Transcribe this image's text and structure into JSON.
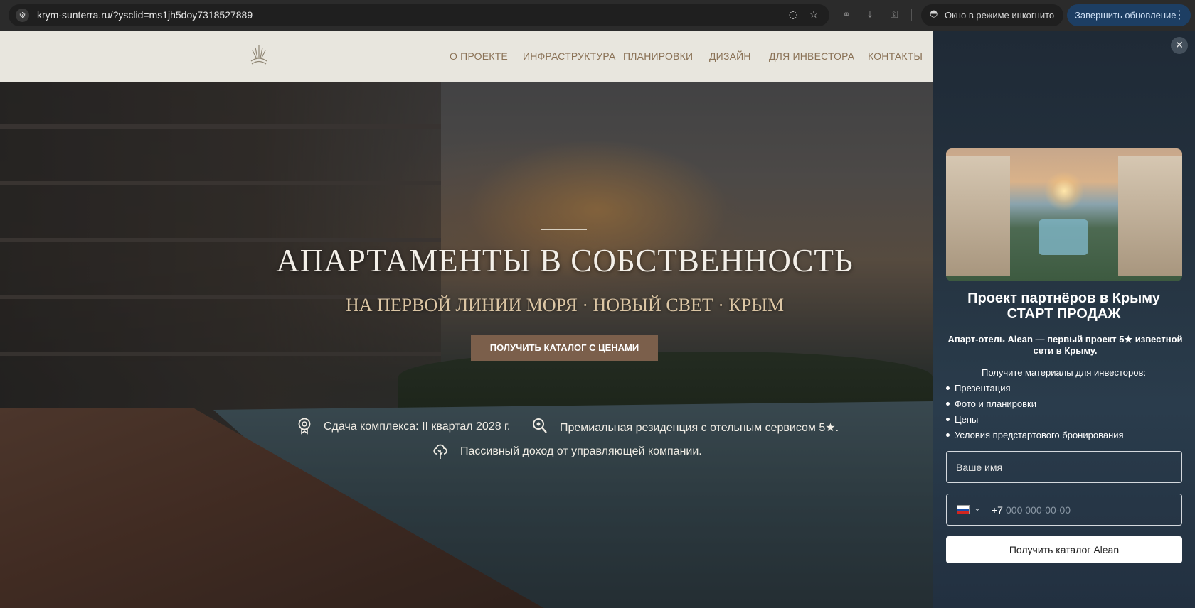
{
  "browser": {
    "url": "krym-sunterra.ru/?ysclid=ms1jh5doy7318527889",
    "incognito_label": "Окно в режиме инкогнито",
    "update_label": "Завершить обновление",
    "icons": [
      "site-info-icon",
      "eye-off-icon",
      "star-icon",
      "link-icon",
      "download-icon",
      "incognito-icon",
      "menu-dots-icon"
    ]
  },
  "site": {
    "nav": [
      "О ПРОЕКТЕ",
      "ИНФРАСТРУКТУРА",
      "ПЛАНИРОВКИ",
      "ДИЗАЙН",
      "ДЛЯ ИНВЕСТОРА",
      "КОНТАКТЫ"
    ],
    "hero_title": "АПАРТАМЕНТЫ В СОБСТВЕННОСТЬ",
    "hero_subtitle": "НА ПЕРВОЙ ЛИНИИ МОРЯ · НОВЫЙ СВЕТ · КРЫМ",
    "cta": "ПОЛУЧИТЬ КАТАЛОГ С ЦЕНАМИ",
    "features": [
      {
        "icon": "location-badge-icon",
        "text": "Сдача комплекса: II квартал 2028 г."
      },
      {
        "icon": "magnifier-icon",
        "text": "Премиальная резиденция с отельным сервисом 5★."
      },
      {
        "icon": "tree-icon",
        "text": "Пассивный доход от управляющей компании."
      }
    ]
  },
  "panel": {
    "title_line1": "Проект партнёров в Крыму",
    "title_line2": "СТАРТ ПРОДАЖ",
    "description": "Апарт-отель Alean — первый проект 5★ известной сети в Крыму.",
    "materials_label": "Получите материалы для инвесторов:",
    "items": [
      "Презентация",
      "Фото и планировки",
      "Цены",
      "Условия предстартового бронирования"
    ],
    "name_placeholder": "Ваше имя",
    "phone_prefix": "+7",
    "phone_placeholder": "000 000-00-00",
    "submit": "Получить каталог Alean"
  },
  "colors": {
    "header_bg": "#e8e6de",
    "nav_text": "#8a7256",
    "cta_bg": "#7b5f4b",
    "panel_bg": "#24323f",
    "update_bg": "#1d3e63"
  }
}
